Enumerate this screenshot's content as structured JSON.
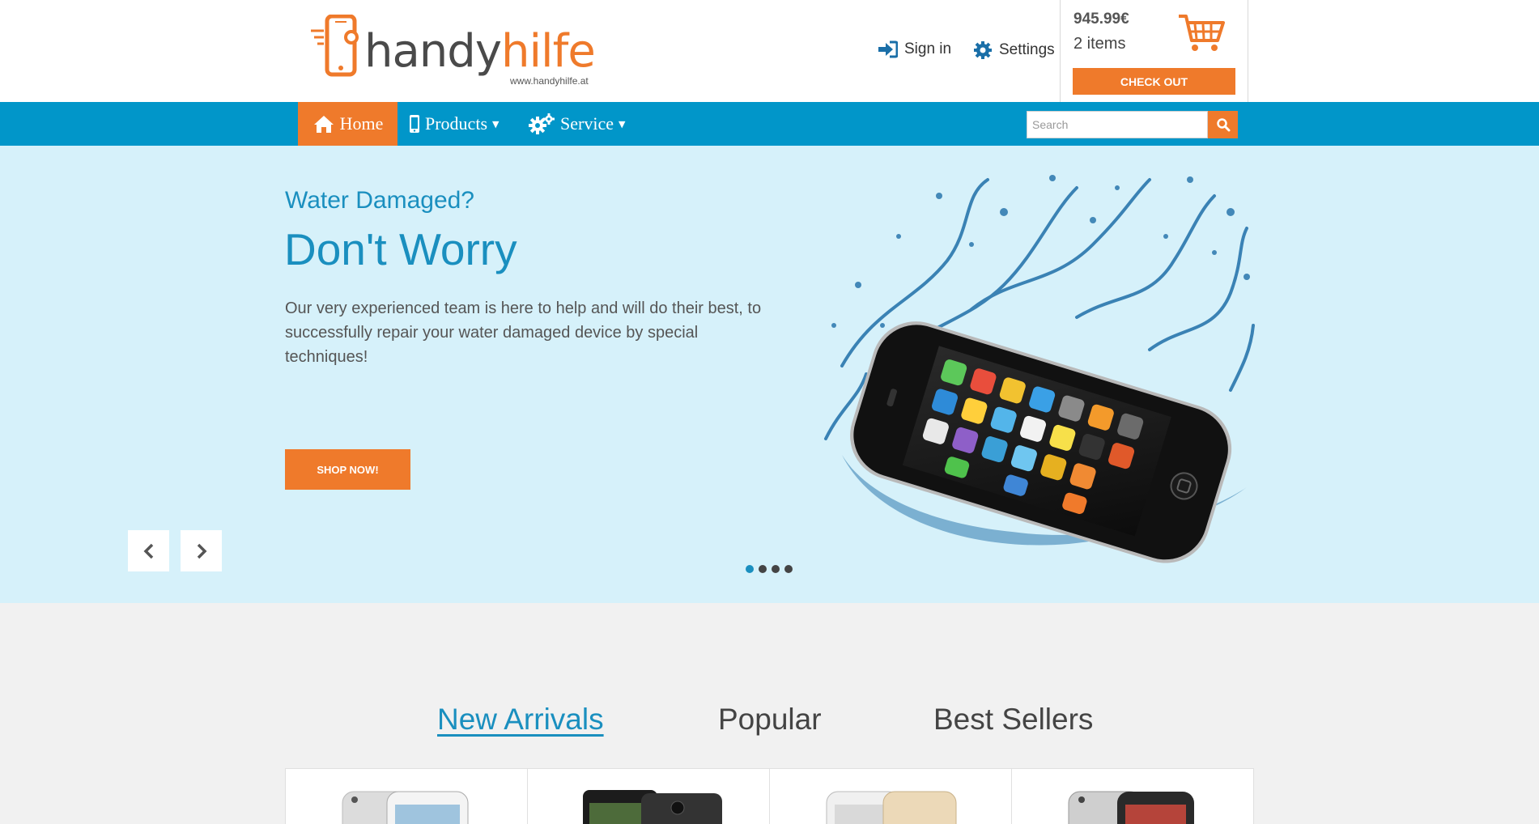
{
  "header": {
    "logo": {
      "brand_part1": "handy",
      "brand_part2": "hilfe",
      "url": "www.handyhilfe.at"
    },
    "signin_label": "Sign in",
    "settings_label": "Settings",
    "cart": {
      "total": "945.99€",
      "items": "2 items",
      "checkout_label": "CHECK OUT"
    }
  },
  "nav": {
    "home_label": "Home",
    "products_label": "Products",
    "service_label": "Service",
    "search_placeholder": "Search",
    "search_value": ""
  },
  "hero": {
    "subtitle": "Water Damaged?",
    "title": "Don't Worry",
    "text": "Our very experienced team is here to help and will do their best, to successfully repair your water damaged device by special techniques!",
    "button_label": "SHOP NOW!",
    "slides": 4,
    "active_slide": 1
  },
  "tabs": {
    "new_arrivals": "New Arrivals",
    "popular": "Popular",
    "best_sellers": "Best Sellers",
    "active": "new_arrivals"
  },
  "colors": {
    "accent": "#ef7a2b",
    "brand_blue": "#0196c9",
    "hero_bg": "#d6f1fa",
    "text_blue": "#1a8fbf"
  },
  "icons": {
    "signin": "sign-in-icon",
    "settings": "gear-icon",
    "cart": "cart-icon",
    "home": "home-icon",
    "products": "mobile-icon",
    "service": "gears-icon",
    "search": "search-icon",
    "prev": "chevron-left-icon",
    "next": "chevron-right-icon"
  }
}
